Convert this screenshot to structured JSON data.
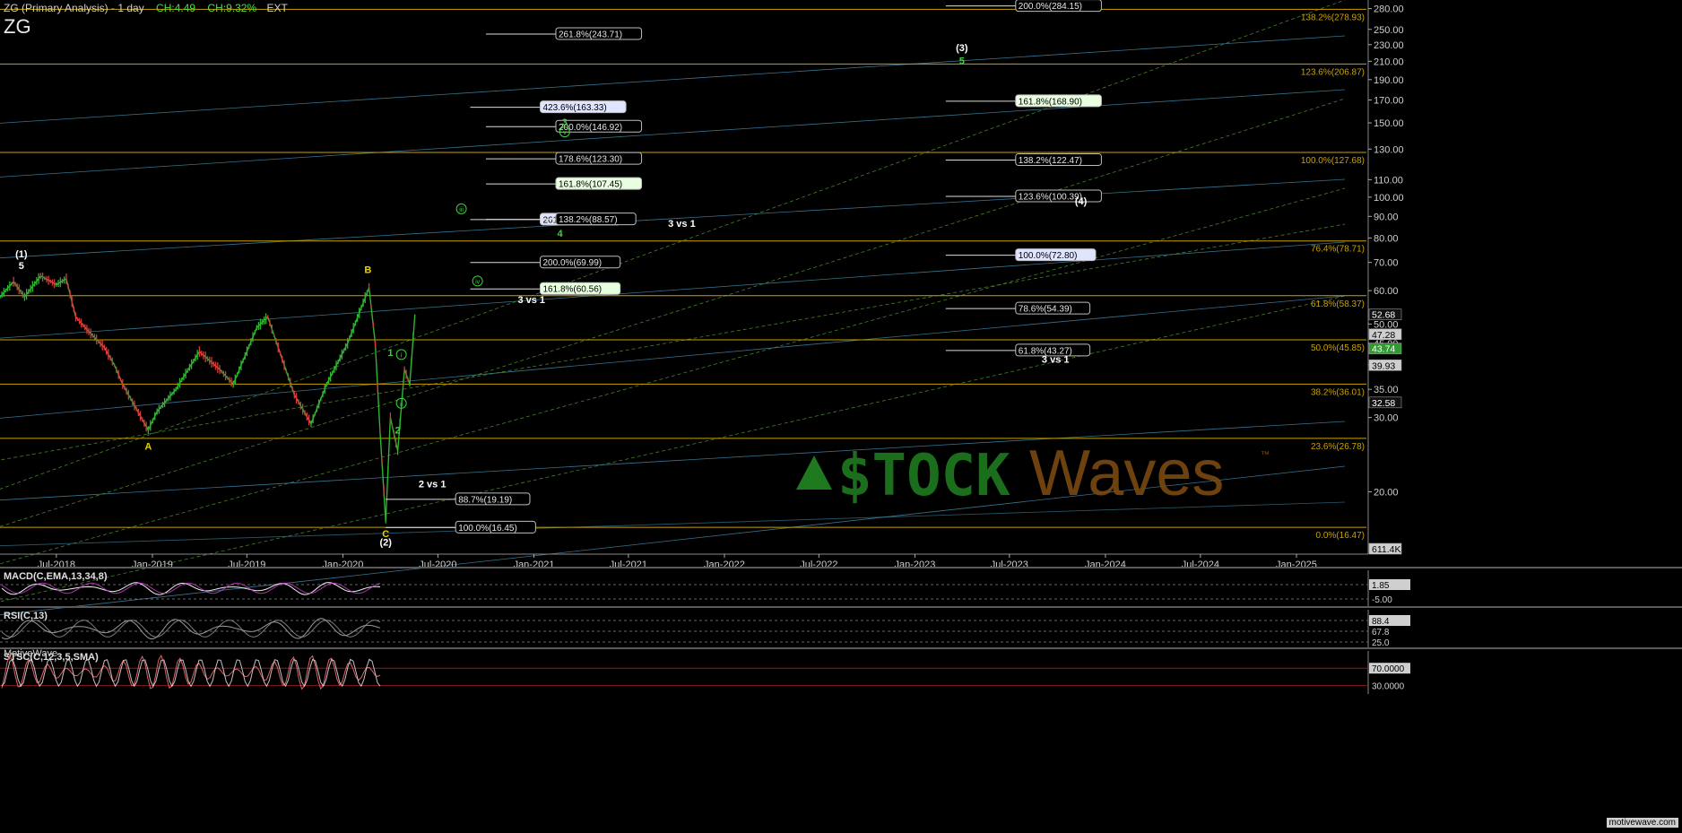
{
  "header": {
    "title": "ZG (Primary Analysis) - 1 day",
    "change_abs": "CH:4.49",
    "change_pct": "CH:9.32%",
    "session": "EXT",
    "symbol": "ZG"
  },
  "brand": {
    "motivewave_label": "MotiveWave",
    "footer": "motivewave.com",
    "watermark_left": "$TOCK",
    "watermark_right": "Waves",
    "watermark_tm": "™"
  },
  "colors": {
    "background": "#000000",
    "fib_line": "#c8a200",
    "fib_text": "#c8a200",
    "wave_green": "#3cd23c",
    "wave_yellow": "#e8d200",
    "wave_white": "#ffffff",
    "up_candle": "#2fb52f",
    "down_candle": "#d43a3a",
    "trend_blue": "#3f7f9e",
    "trend_green": "#4f8f2f",
    "macd_line": "#f0f0f0",
    "macd_signal": "#d040d0",
    "rsi_line": "#9a9a9a",
    "stoch_k": "#e06060",
    "stoch_d": "#f0f0f0"
  },
  "chart_data": {
    "type": "candlestick",
    "title": "ZG (Primary Analysis) - 1 day",
    "price_axis": {
      "scale": "log",
      "range": [
        16.0,
        285.0
      ],
      "ticks": [
        20.0,
        30.0,
        35.0,
        40.0,
        45.0,
        50.0,
        60.0,
        70.0,
        80.0,
        90.0,
        100.0,
        110.0,
        130.0,
        150.0,
        170.0,
        190.0,
        210.0,
        230.0,
        250.0,
        280.0
      ],
      "tick_labels": [
        "20.00",
        "30.00",
        "35.00",
        "40.00",
        "45.00",
        "50.00",
        "60.00",
        "70.00",
        "80.00",
        "90.00",
        "100.00",
        "110.00",
        "130.00",
        "150.00",
        "170.00",
        "190.00",
        "210.00",
        "230.00",
        "250.00",
        "280.00"
      ],
      "price_tags": [
        {
          "label": "52.68",
          "value": 52.68,
          "style": "white"
        },
        {
          "label": "47.28",
          "value": 47.28,
          "style": "grey"
        },
        {
          "label": "43.74",
          "value": 43.74,
          "style": "green"
        },
        {
          "label": "39.93",
          "value": 39.93,
          "style": "grey"
        },
        {
          "label": "32.58",
          "value": 32.58,
          "style": "white"
        },
        {
          "label": "611.4K",
          "value": 16.0,
          "style": "grey"
        }
      ]
    },
    "time_axis": {
      "range": [
        "2018-03-15",
        "2025-05-15"
      ],
      "tick_labels": [
        "Jul-2018",
        "Jan-2019",
        "Jul-2019",
        "Jan-2020",
        "Jul-2020",
        "Jan-2021",
        "Jul-2021",
        "Jan-2022",
        "Jul-2022",
        "Jan-2023",
        "Jul-2023",
        "Jan-2024",
        "Jul-2024",
        "Jan-2025"
      ],
      "tick_dates": [
        "2018-07-01",
        "2019-01-01",
        "2019-07-01",
        "2020-01-01",
        "2020-07-01",
        "2021-01-01",
        "2021-07-01",
        "2022-01-01",
        "2022-07-01",
        "2023-01-01",
        "2023-07-01",
        "2024-01-01",
        "2024-07-01",
        "2025-01-01"
      ]
    },
    "price_path": [
      [
        "2018-03-15",
        58.0
      ],
      [
        "2018-04-10",
        63.0
      ],
      [
        "2018-05-01",
        58.0
      ],
      [
        "2018-06-01",
        65.0
      ],
      [
        "2018-07-01",
        62.0
      ],
      [
        "2018-07-20",
        64.0
      ],
      [
        "2018-08-07",
        52.0
      ],
      [
        "2018-09-01",
        48.0
      ],
      [
        "2018-10-01",
        44.0
      ],
      [
        "2018-10-20",
        40.0
      ],
      [
        "2018-11-05",
        36.0
      ],
      [
        "2018-12-24",
        28.0
      ],
      [
        "2019-01-10",
        31.0
      ],
      [
        "2019-02-15",
        35.0
      ],
      [
        "2019-04-01",
        43.0
      ],
      [
        "2019-05-10",
        39.0
      ],
      [
        "2019-06-05",
        36.0
      ],
      [
        "2019-07-20",
        49.0
      ],
      [
        "2019-08-10",
        52.0
      ],
      [
        "2019-08-30",
        44.0
      ],
      [
        "2019-09-30",
        34.0
      ],
      [
        "2019-11-01",
        29.0
      ],
      [
        "2019-12-01",
        36.0
      ],
      [
        "2020-01-10",
        45.0
      ],
      [
        "2020-02-20",
        61.0
      ],
      [
        "2020-03-03",
        45.0
      ],
      [
        "2020-03-12",
        28.0
      ],
      [
        "2020-03-23",
        17.0
      ],
      [
        "2020-04-01",
        30.0
      ],
      [
        "2020-04-15",
        25.0
      ],
      [
        "2020-04-28",
        39.0
      ],
      [
        "2020-05-08",
        36.0
      ],
      [
        "2020-05-18",
        52.68
      ]
    ],
    "fib_levels": [
      {
        "label": "138.2%(278.93)",
        "value": 278.93
      },
      {
        "label": "123.6%(206.87)",
        "value": 206.87
      },
      {
        "label": "100.0%(127.68)",
        "value": 127.68
      },
      {
        "label": "76.4%(78.71)",
        "value": 78.71
      },
      {
        "label": "61.8%(58.37)",
        "value": 58.37
      },
      {
        "label": "50.0%(45.85)",
        "value": 45.85
      },
      {
        "label": "38.2%(36.01)",
        "value": 36.01
      },
      {
        "label": "23.6%(26.78)",
        "value": 26.78
      },
      {
        "label": "0.0%(16.47)",
        "value": 16.47
      }
    ],
    "projection_boxes": [
      {
        "label": "261.8%(243.71)",
        "value": 243.71,
        "style": "plain",
        "date": "2020-10-01"
      },
      {
        "label": "423.6%(163.33)",
        "value": 163.33,
        "style": "blue",
        "date": "2020-09-01"
      },
      {
        "label": "200.0%(146.92)",
        "value": 146.92,
        "style": "plain",
        "date": "2020-10-01"
      },
      {
        "label": "178.6%(123.30)",
        "value": 123.3,
        "style": "plain",
        "date": "2020-10-01"
      },
      {
        "label": "161.8%(107.45)",
        "value": 107.45,
        "style": "green",
        "date": "2020-10-01"
      },
      {
        "label": "261.8%(88.46)",
        "value": 88.46,
        "style": "blue",
        "date": "2020-09-01"
      },
      {
        "label": "138.2%(88.57)",
        "value": 88.57,
        "style": "plain",
        "date": "2020-10-01"
      },
      {
        "label": "200.0%(69.99)",
        "value": 69.99,
        "style": "plain",
        "date": "2020-09-01"
      },
      {
        "label": "161.8%(60.56)",
        "value": 60.56,
        "style": "green",
        "date": "2020-09-01"
      },
      {
        "label": "88.7%(19.19)",
        "value": 19.19,
        "style": "plain",
        "date": "2020-03-23"
      },
      {
        "label": "100.0%(16.45)",
        "value": 16.45,
        "style": "plain",
        "date": "2020-03-23"
      },
      {
        "label": "200.0%(284.15)",
        "value": 284.15,
        "style": "plain",
        "date": "2023-03-01"
      },
      {
        "label": "161.8%(168.90)",
        "value": 168.9,
        "style": "green",
        "date": "2023-03-01"
      },
      {
        "label": "138.2%(122.47)",
        "value": 122.47,
        "style": "plain",
        "date": "2023-03-01"
      },
      {
        "label": "123.6%(100.39)",
        "value": 100.39,
        "style": "plain",
        "date": "2023-03-01"
      },
      {
        "label": "100.0%(72.80)",
        "value": 72.8,
        "style": "blue",
        "date": "2023-03-01"
      },
      {
        "label": "78.6%(54.39)",
        "value": 54.39,
        "style": "plain",
        "date": "2023-03-01"
      },
      {
        "label": "61.8%(43.27)",
        "value": 43.27,
        "style": "plain",
        "date": "2023-03-01"
      }
    ],
    "ratio_notes": [
      {
        "text": "3 vs 1",
        "date": "2021-09-15",
        "value": 85.0
      },
      {
        "text": "3 vs 1",
        "date": "2020-12-01",
        "value": 56.0
      },
      {
        "text": "3 vs 1",
        "date": "2023-09-01",
        "value": 40.5
      },
      {
        "text": "2 vs 1",
        "date": "2020-05-25",
        "value": 20.5
      }
    ],
    "wave_labels": [
      {
        "text": "(1)",
        "date": "2018-04-25",
        "value": 72.0,
        "color": "white"
      },
      {
        "text": "5",
        "date": "2018-04-25",
        "value": 67.5,
        "color": "white"
      },
      {
        "text": "A",
        "date": "2018-12-24",
        "value": 25.2,
        "color": "yellow"
      },
      {
        "text": "B",
        "date": "2020-02-18",
        "value": 66.0,
        "color": "yellow"
      },
      {
        "text": "C",
        "date": "2020-03-23",
        "value": 15.6,
        "color": "yellow"
      },
      {
        "text": "(2)",
        "date": "2020-03-23",
        "value": 14.9,
        "color": "white"
      },
      {
        "text": "1",
        "date": "2020-04-01",
        "value": 42.0,
        "color": "green"
      },
      {
        "text": "2",
        "date": "2020-04-15",
        "value": 27.5,
        "color": "green"
      },
      {
        "text": "i",
        "date": "2020-04-22",
        "value": 41.5,
        "color": "green",
        "circled": true
      },
      {
        "text": "ii",
        "date": "2020-04-22",
        "value": 31.8,
        "color": "green",
        "circled": true
      },
      {
        "text": "iii",
        "date": "2020-08-15",
        "value": 92.0,
        "color": "green",
        "circled": true
      },
      {
        "text": "iv",
        "date": "2020-09-15",
        "value": 62.0,
        "color": "green",
        "circled": true
      },
      {
        "text": "3",
        "date": "2021-03-01",
        "value": 148.0,
        "color": "green"
      },
      {
        "text": "v",
        "date": "2021-03-01",
        "value": 140.0,
        "color": "green",
        "circled": true
      },
      {
        "text": "4",
        "date": "2021-02-20",
        "value": 80.5,
        "color": "green"
      },
      {
        "text": "(3)",
        "date": "2023-04-01",
        "value": 222.0,
        "color": "white"
      },
      {
        "text": "5",
        "date": "2023-04-01",
        "value": 207.0,
        "color": "green"
      },
      {
        "text": "(4)",
        "date": "2023-11-15",
        "value": 96.0,
        "color": "white"
      }
    ],
    "panes": [
      {
        "name": "MACD(C,EMA,13,34,8)",
        "axis_labels": [
          "1.85",
          "-5.00"
        ]
      },
      {
        "name": "RSI(C,13)",
        "axis_labels": [
          "88.4",
          "67.8",
          "25.0"
        ]
      },
      {
        "name": "STSC(C,12,3,5,SMA)",
        "axis_labels": [
          "70.0000",
          "30.0000"
        ]
      }
    ]
  }
}
